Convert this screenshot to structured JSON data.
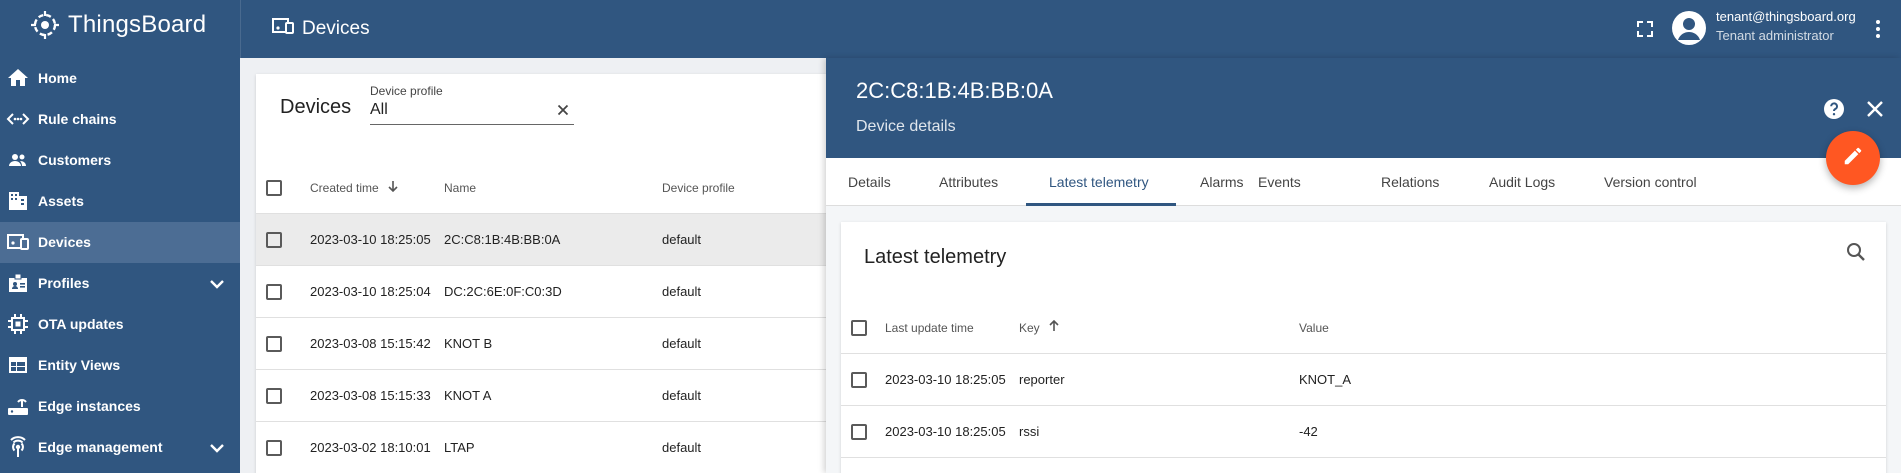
{
  "app": {
    "brand": "ThingsBoard",
    "page_title": "Devices",
    "user_email": "tenant@thingsboard.org",
    "user_role": "Tenant administrator"
  },
  "colors": {
    "primary": "#305680",
    "sidebar_active": "#4c6d94",
    "fab": "#ff5722",
    "row_selected": "#ebebeb"
  },
  "sidebar": {
    "items": [
      {
        "label": "Home",
        "icon": "home-icon"
      },
      {
        "label": "Rule chains",
        "icon": "rule-chain-icon"
      },
      {
        "label": "Customers",
        "icon": "customers-icon"
      },
      {
        "label": "Assets",
        "icon": "assets-icon"
      },
      {
        "label": "Devices",
        "icon": "devices-icon",
        "active": true
      },
      {
        "label": "Profiles",
        "icon": "profiles-icon",
        "expandable": true
      },
      {
        "label": "OTA updates",
        "icon": "ota-icon"
      },
      {
        "label": "Entity Views",
        "icon": "entity-views-icon"
      },
      {
        "label": "Edge instances",
        "icon": "edge-icon"
      },
      {
        "label": "Edge management",
        "icon": "edge-management-icon",
        "expandable": true
      }
    ]
  },
  "devices": {
    "title": "Devices",
    "filter_label": "Device profile",
    "filter_value": "All",
    "columns": [
      "Created time",
      "Name",
      "Device profile"
    ],
    "sort_column": "Created time",
    "sort_direction": "desc",
    "rows": [
      {
        "created": "2023-03-10 18:25:05",
        "name": "2C:C8:1B:4B:BB:0A",
        "profile": "default",
        "selected": true
      },
      {
        "created": "2023-03-10 18:25:04",
        "name": "DC:2C:6E:0F:C0:3D",
        "profile": "default"
      },
      {
        "created": "2023-03-08 15:15:42",
        "name": "KNOT B",
        "profile": "default"
      },
      {
        "created": "2023-03-08 15:15:33",
        "name": "KNOT A",
        "profile": "default"
      },
      {
        "created": "2023-03-02 18:10:01",
        "name": "LTAP",
        "profile": "default"
      }
    ]
  },
  "detail": {
    "title": "2C:C8:1B:4B:BB:0A",
    "subtitle": "Device details",
    "tabs": [
      "Details",
      "Attributes",
      "Latest telemetry",
      "Alarms",
      "Events",
      "Relations",
      "Audit Logs",
      "Version control"
    ],
    "active_tab": "Latest telemetry",
    "telemetry": {
      "title": "Latest telemetry",
      "columns": [
        "Last update time",
        "Key",
        "Value"
      ],
      "sort_column": "Key",
      "sort_direction": "asc",
      "rows": [
        {
          "time": "2023-03-10 18:25:05",
          "key": "reporter",
          "value": "KNOT_A"
        },
        {
          "time": "2023-03-10 18:25:05",
          "key": "rssi",
          "value": "-42"
        }
      ]
    }
  }
}
